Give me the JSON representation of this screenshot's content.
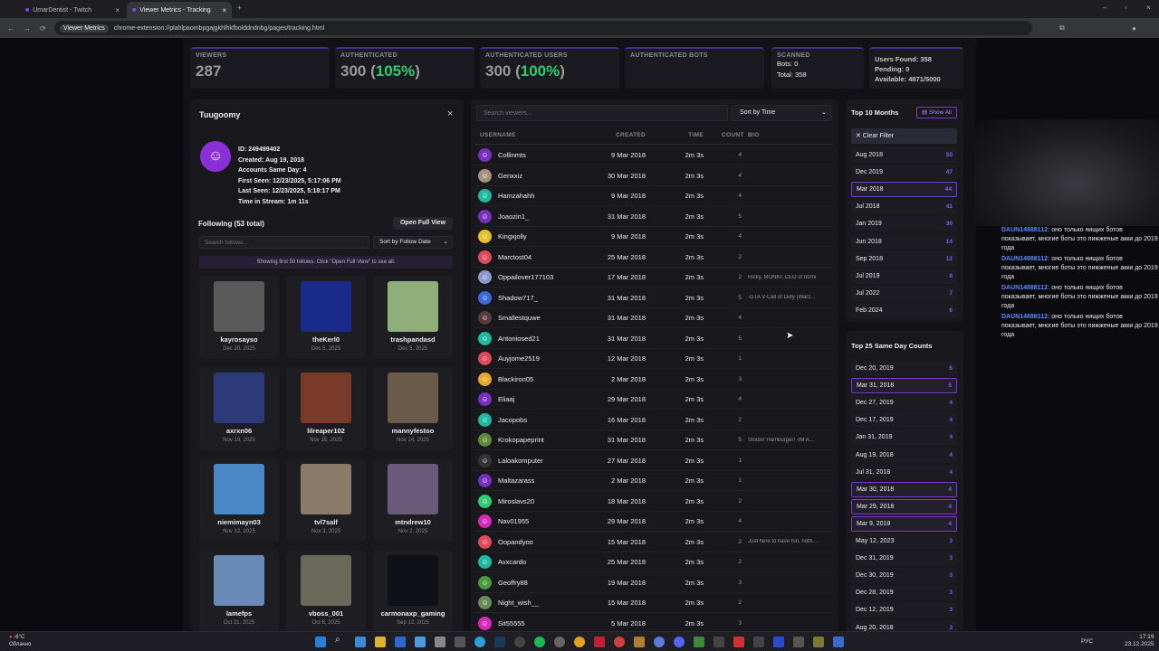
{
  "browser": {
    "tabs": [
      {
        "title": "UmarDentist - Twitch"
      },
      {
        "title": "Viewer Metrics - Tracking"
      }
    ],
    "address_chip": "Viewer Metrics",
    "url": "chrome-extension://plahlpaombpgajgkhlhkfbolddndnbg/pages/tracking.html"
  },
  "stats": {
    "viewers_label": "VIEWERS",
    "viewers": "287",
    "auth_label": "AUTHENTICATED",
    "auth_num": "300 (",
    "auth_pct": "105%",
    "auth_close": ")",
    "auth_users_label": "AUTHENTICATED USERS",
    "auth_users_num": "300 (",
    "auth_users_pct": "100%",
    "auth_users_close": ")",
    "auth_bots_label": "AUTHENTICATED BOTS",
    "scanned_label": "SCANNED",
    "bots": "Bots: 0",
    "total": "Total: 358",
    "users_found": "Users Found: 358",
    "pending": "Pending: 0",
    "available": "Available: 4871/5000"
  },
  "profile": {
    "name": "Tuugoomy",
    "close": "×",
    "id": "ID: 249499402",
    "created": "Created: Aug 19, 2018",
    "same_day": "Accounts Same Day: 4",
    "first_seen": "First Seen: 12/23/2025, 5:17:06 PM",
    "last_seen": "Last Seen: 12/23/2025, 5:18:17 PM",
    "time_in_stream": "Time in Stream: 1m 11s",
    "following": "Following (53 total)",
    "open_full": "Open Full View",
    "search_placeholder": "Search follows...",
    "sort": "Sort by Follow Date",
    "notice": "Showing first 50 follows. Click \"Open Full View\" to see all.",
    "follows": [
      {
        "name": "kayrosayso",
        "date": "Dec 20, 2025",
        "color": "#5a5a5a"
      },
      {
        "name": "theKerl0",
        "date": "Dec 5, 2025",
        "color": "#1a2a8a"
      },
      {
        "name": "trashpandasd",
        "date": "Dec 5, 2025",
        "color": "#8fae7a"
      },
      {
        "name": "axrxn06",
        "date": "Nov 19, 2025",
        "color": "#2d3a7a"
      },
      {
        "name": "lilreaper102",
        "date": "Nov 15, 2025",
        "color": "#7a3a2a"
      },
      {
        "name": "mannyfestoo",
        "date": "Nov 14, 2025",
        "color": "#6a5a4a"
      },
      {
        "name": "niemimayn03",
        "date": "Nov 12, 2025",
        "color": "#4a88c8"
      },
      {
        "name": "tvl7salf",
        "date": "Nov 3, 2025",
        "color": "#8a7a6a"
      },
      {
        "name": "mtndrew10",
        "date": "Nov 2, 2025",
        "color": "#6a5a7a"
      },
      {
        "name": "lamefps",
        "date": "Oct 21, 2025",
        "color": "#6a8ab8"
      },
      {
        "name": "vboss_001",
        "date": "Oct 6, 2025",
        "color": "#6a6a5a"
      },
      {
        "name": "carmonaxp_gaming",
        "date": "Sep 12, 2025",
        "color": "#101018"
      }
    ]
  },
  "viewers": {
    "search_placeholder": "Search viewers...",
    "sort": "Sort by Time",
    "headers": {
      "user": "USERNAME",
      "created": "CREATED",
      "time": "TIME",
      "count": "COUNT",
      "bio": "BIO"
    },
    "rows": [
      {
        "u": "Collinmts",
        "c": "9 Mar 2018",
        "t": "2m 3s",
        "n": "4",
        "b": "",
        "col": "#7b2fbf"
      },
      {
        "u": "Genxxiz",
        "c": "30 Mar 2018",
        "t": "2m 3s",
        "n": "4",
        "b": "",
        "col": "#a89080"
      },
      {
        "u": "Hamzahahh",
        "c": "9 Mar 2018",
        "t": "2m 3s",
        "n": "4",
        "b": "",
        "col": "#1fb8a0"
      },
      {
        "u": "Joaozin1_",
        "c": "31 Mar 2018",
        "t": "2m 3s",
        "n": "5",
        "b": "",
        "col": "#7b2fbf"
      },
      {
        "u": "Kingxjolly",
        "c": "9 Mar 2018",
        "t": "2m 3s",
        "n": "4",
        "b": "",
        "col": "#e6c228"
      },
      {
        "u": "Marctost04",
        "c": "25 Mar 2018",
        "t": "2m 3s",
        "n": "2",
        "b": "",
        "col": "#e04a5a"
      },
      {
        "u": "Oppailover177103",
        "c": "17 Mar 2018",
        "t": "2m 3s",
        "n": "2",
        "b": "Ricky, MONKI, CEO of horni",
        "col": "#8899cc"
      },
      {
        "u": "Shadow717_",
        "c": "31 Mar 2018",
        "t": "2m 3s",
        "n": "5",
        "b": "-GTA V-Call of Duty (Warz...",
        "col": "#3a6ad8"
      },
      {
        "u": "Smallestquwe",
        "c": "31 Mar 2018",
        "t": "2m 3s",
        "n": "4",
        "b": "",
        "col": "#5a3a3a"
      },
      {
        "u": "Antoniosed21",
        "c": "31 Mar 2018",
        "t": "2m 3s",
        "n": "5",
        "b": "",
        "col": "#1fb8a0"
      },
      {
        "u": "Auyjome2519",
        "c": "12 Mar 2018",
        "t": "2m 3s",
        "n": "1",
        "b": "",
        "col": "#e04a5a"
      },
      {
        "u": "Blackiron05",
        "c": "2 Mar 2018",
        "t": "2m 3s",
        "n": "3",
        "b": "",
        "col": "#e6a828"
      },
      {
        "u": "Eliaaj",
        "c": "29 Mar 2018",
        "t": "2m 3s",
        "n": "4",
        "b": "",
        "col": "#7b2fbf"
      },
      {
        "u": "Jacopobs",
        "c": "16 Mar 2018",
        "t": "2m 3s",
        "n": "2",
        "b": "",
        "col": "#1fb8a0"
      },
      {
        "u": "Krokopapeprint",
        "c": "31 Mar 2018",
        "t": "2m 3s",
        "n": "5",
        "b": "Stolzer Hamburger! -IM A...",
        "col": "#5a8a3a"
      },
      {
        "u": "Laloakomputer",
        "c": "27 Mar 2018",
        "t": "2m 3s",
        "n": "1",
        "b": "",
        "col": "#333"
      },
      {
        "u": "Maltazarass",
        "c": "2 Mar 2018",
        "t": "2m 3s",
        "n": "1",
        "b": "",
        "col": "#7b2fbf"
      },
      {
        "u": "Miroslavs20",
        "c": "18 Mar 2018",
        "t": "2m 3s",
        "n": "2",
        "b": "",
        "col": "#2ecc71"
      },
      {
        "u": "Nav01955",
        "c": "29 Mar 2018",
        "t": "2m 3s",
        "n": "4",
        "b": "",
        "col": "#d82ab8"
      },
      {
        "u": "Oopandyoo",
        "c": "15 Mar 2018",
        "t": "2m 3s",
        "n": "2",
        "b": "Just here to have fun, noth...",
        "col": "#e04a5a"
      },
      {
        "u": "Avxcardo",
        "c": "25 Mar 2018",
        "t": "2m 3s",
        "n": "2",
        "b": "",
        "col": "#1fb8a0"
      },
      {
        "u": "Geoffry88",
        "c": "19 Mar 2018",
        "t": "2m 3s",
        "n": "3",
        "b": "",
        "col": "#4a9a3a"
      },
      {
        "u": "Night_wish__",
        "c": "15 Mar 2018",
        "t": "2m 3s",
        "n": "2",
        "b": "",
        "col": "#6a8a5a"
      },
      {
        "u": "Sit55555",
        "c": "5 Mar 2018",
        "t": "2m 3s",
        "n": "3",
        "b": "",
        "col": "#d82ab8"
      }
    ]
  },
  "top_months": {
    "title": "Top 10 Months",
    "show_all": "Show All",
    "clear": "✕ Clear Filter",
    "rows": [
      {
        "m": "Aug 2018",
        "n": "50"
      },
      {
        "m": "Dec 2019",
        "n": "47"
      },
      {
        "m": "Mar 2018",
        "n": "44",
        "hl": true
      },
      {
        "m": "Jul 2018",
        "n": "41"
      },
      {
        "m": "Jan 2019",
        "n": "30"
      },
      {
        "m": "Jun 2018",
        "n": "14"
      },
      {
        "m": "Sep 2018",
        "n": "12"
      },
      {
        "m": "Jul 2019",
        "n": "8"
      },
      {
        "m": "Jul 2022",
        "n": "7"
      },
      {
        "m": "Feb 2024",
        "n": "6"
      }
    ]
  },
  "same_day": {
    "title": "Top 25 Same Day Counts",
    "rows": [
      {
        "d": "Dec 20, 2019",
        "n": "6"
      },
      {
        "d": "Mar 31, 2018",
        "n": "5",
        "hl": true
      },
      {
        "d": "Dec 27, 2019",
        "n": "4"
      },
      {
        "d": "Dec 17, 2019",
        "n": "4"
      },
      {
        "d": "Jan 31, 2019",
        "n": "4"
      },
      {
        "d": "Aug 19, 2018",
        "n": "4"
      },
      {
        "d": "Jul 31, 2018",
        "n": "4"
      },
      {
        "d": "Mar 30, 2018",
        "n": "4",
        "hl": true
      },
      {
        "d": "Mar 29, 2018",
        "n": "4",
        "hl": true
      },
      {
        "d": "Mar 9, 2018",
        "n": "4",
        "hl": true
      },
      {
        "d": "May 12, 2023",
        "n": "3"
      },
      {
        "d": "Dec 31, 2019",
        "n": "3"
      },
      {
        "d": "Dec 30, 2019",
        "n": "3"
      },
      {
        "d": "Dec 28, 2019",
        "n": "3"
      },
      {
        "d": "Dec 12, 2019",
        "n": "3"
      },
      {
        "d": "Aug 20, 2018",
        "n": "3"
      }
    ]
  },
  "chat": [
    {
      "user": "DAUN14888112:",
      "msg": "оно только нищих ботов показывает, многие боты это пижженые акки до 2019 года"
    },
    {
      "user": "DAUN14888112:",
      "msg": "оно только нищих ботов показывает, многие боты это пижженые акки до 2019 года"
    },
    {
      "user": "DAUN14888112:",
      "msg": "оно только нищих ботов показывает, многие боты это пижженые акки до 2019 года"
    },
    {
      "user": "DAUN14888112:",
      "msg": "оно только нищих ботов показывает, многие боты это пижженые акки до 2019 года"
    }
  ],
  "taskbar": {
    "weather_temp": "-6°C",
    "weather_desc": "Облачно",
    "lang": "РУС",
    "time": "17:19",
    "date": "23.12.2025"
  }
}
